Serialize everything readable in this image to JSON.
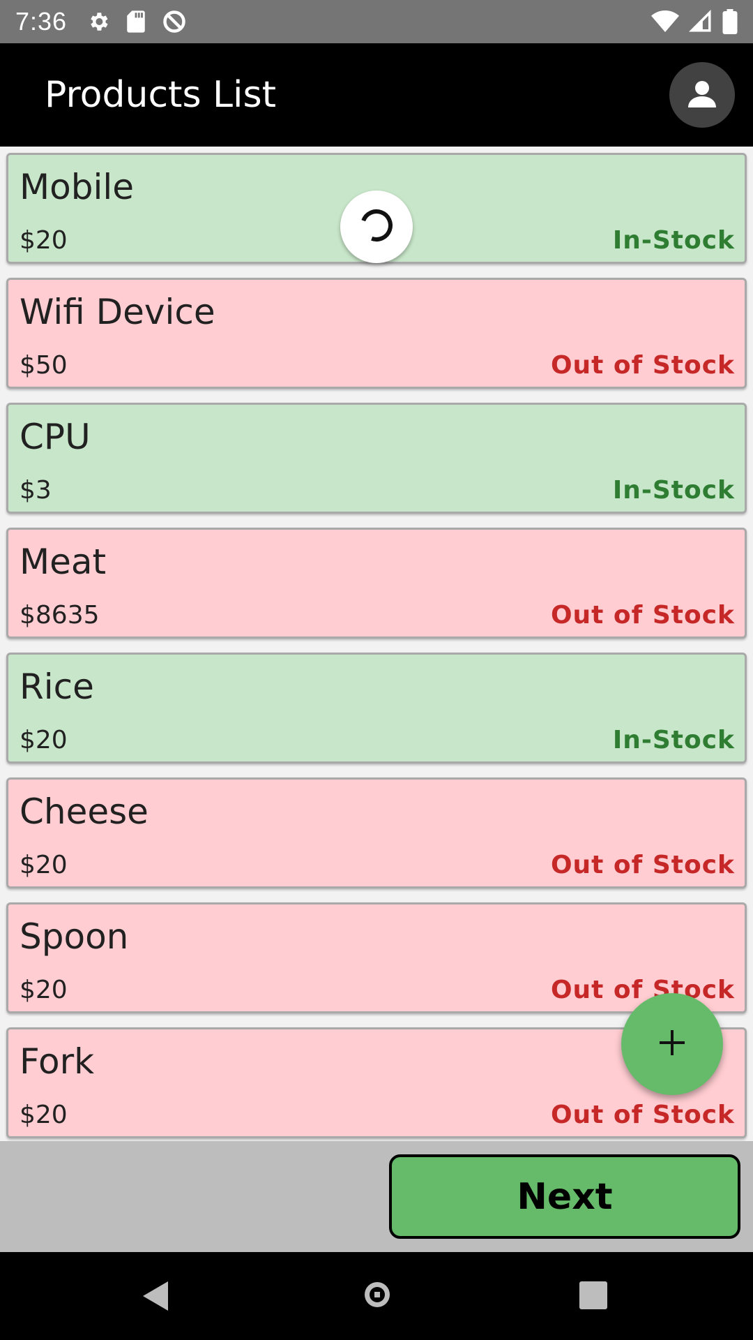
{
  "status_bar": {
    "time": "7:36",
    "left_icons": [
      "settings-icon",
      "sd-card-icon",
      "data-saver-icon"
    ],
    "right_icons": [
      "wifi-icon",
      "cellular-signal-icon",
      "battery-icon"
    ]
  },
  "app_bar": {
    "title": "Products List",
    "avatar_icon": "account-icon"
  },
  "products": [
    {
      "name": "Mobile",
      "price": "$20",
      "status": "In-Stock"
    },
    {
      "name": "Wifi Device",
      "price": "$50",
      "status": "Out of Stock"
    },
    {
      "name": "CPU",
      "price": "$3",
      "status": "In-Stock"
    },
    {
      "name": "Meat",
      "price": "$8635",
      "status": "Out of Stock"
    },
    {
      "name": "Rice",
      "price": "$20",
      "status": "In-Stock"
    },
    {
      "name": "Cheese",
      "price": "$20",
      "status": "Out of Stock"
    },
    {
      "name": "Spoon",
      "price": "$20",
      "status": "Out of Stock"
    },
    {
      "name": "Fork",
      "price": "$20",
      "status": "Out of Stock"
    }
  ],
  "loading": {
    "icon": "loading-spinner-icon"
  },
  "fab": {
    "icon": "plus-icon"
  },
  "bottom_bar": {
    "next_label": "Next"
  },
  "nav_bar": {
    "icons": [
      "back-icon",
      "home-icon",
      "recents-icon"
    ]
  },
  "colors": {
    "in_stock_bg": "#c8e6c9",
    "out_stock_bg": "#ffcdd2",
    "in_stock_text": "#2e7d32",
    "out_stock_text": "#c62828",
    "accent_green": "#66bb6a",
    "app_bar": "#000000",
    "status_bar": "#757575"
  }
}
